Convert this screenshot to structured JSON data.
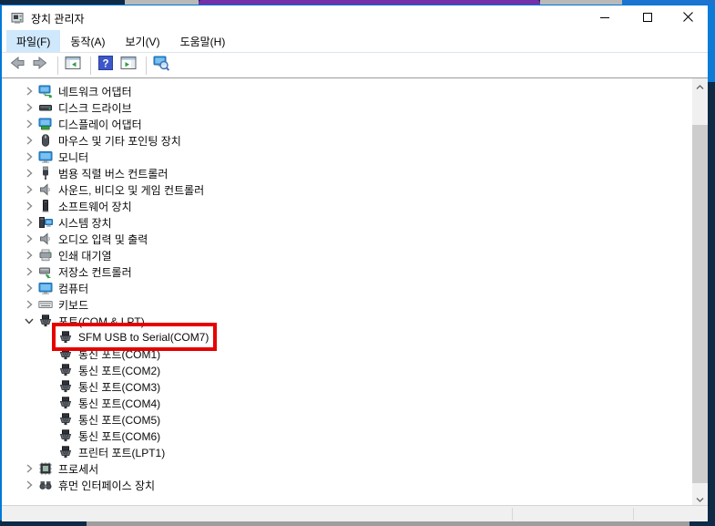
{
  "window": {
    "title": "장치 관리자",
    "app_icon": "device-manager",
    "controls": [
      {
        "name": "minimize",
        "icon": "minimize"
      },
      {
        "name": "maximize",
        "icon": "maximize"
      },
      {
        "name": "close",
        "icon": "close"
      }
    ]
  },
  "menu": {
    "items": [
      {
        "name": "file",
        "label": "파일(F)",
        "highlighted": true
      },
      {
        "name": "action",
        "label": "동작(A)",
        "highlighted": false
      },
      {
        "name": "view",
        "label": "보기(V)",
        "highlighted": false
      },
      {
        "name": "help",
        "label": "도움말(H)",
        "highlighted": false
      }
    ]
  },
  "toolbar": {
    "buttons": [
      {
        "name": "back",
        "icon": "back-arrow"
      },
      {
        "name": "forward",
        "icon": "forward-arrow"
      },
      {
        "name": "separator"
      },
      {
        "name": "console-tree",
        "icon": "console-tree"
      },
      {
        "name": "separator"
      },
      {
        "name": "help",
        "icon": "help"
      },
      {
        "name": "action-pane",
        "icon": "action-pane"
      },
      {
        "name": "separator"
      },
      {
        "name": "scan-hardware",
        "icon": "scan-hardware"
      }
    ]
  },
  "tree": {
    "items": [
      {
        "name": "network-adapters",
        "label": "네트워크 어댑터",
        "icon": "network-adapter",
        "level": 1,
        "chevron": "collapsed",
        "highlighted": false
      },
      {
        "name": "disk-drives",
        "label": "디스크 드라이브",
        "icon": "disk-drive",
        "level": 1,
        "chevron": "collapsed",
        "highlighted": false
      },
      {
        "name": "display-adapters",
        "label": "디스플레이 어댑터",
        "icon": "display-adapter",
        "level": 1,
        "chevron": "collapsed",
        "highlighted": false
      },
      {
        "name": "mice-pointing-devices",
        "label": "마우스 및 기타 포인팅 장치",
        "icon": "mouse",
        "level": 1,
        "chevron": "collapsed",
        "highlighted": false
      },
      {
        "name": "monitors",
        "label": "모니터",
        "icon": "monitor",
        "level": 1,
        "chevron": "collapsed",
        "highlighted": false
      },
      {
        "name": "usb-controllers",
        "label": "범용 직렬 버스 컨트롤러",
        "icon": "usb",
        "level": 1,
        "chevron": "collapsed",
        "highlighted": false
      },
      {
        "name": "sound-video-game-controllers",
        "label": "사운드, 비디오 및 게임 컨트롤러",
        "icon": "speaker",
        "level": 1,
        "chevron": "collapsed",
        "highlighted": false
      },
      {
        "name": "software-devices",
        "label": "소프트웨어 장치",
        "icon": "software-device",
        "level": 1,
        "chevron": "collapsed",
        "highlighted": false
      },
      {
        "name": "system-devices",
        "label": "시스템 장치",
        "icon": "system-device",
        "level": 1,
        "chevron": "collapsed",
        "highlighted": false
      },
      {
        "name": "audio-inputs-outputs",
        "label": "오디오 입력 및 출력",
        "icon": "speaker",
        "level": 1,
        "chevron": "collapsed",
        "highlighted": false
      },
      {
        "name": "print-queues",
        "label": "인쇄 대기열",
        "icon": "printer",
        "level": 1,
        "chevron": "collapsed",
        "highlighted": false
      },
      {
        "name": "storage-controllers",
        "label": "저장소 컨트롤러",
        "icon": "storage",
        "level": 1,
        "chevron": "collapsed",
        "highlighted": false
      },
      {
        "name": "computer",
        "label": "컴퓨터",
        "icon": "computer",
        "level": 1,
        "chevron": "collapsed",
        "highlighted": false
      },
      {
        "name": "keyboards",
        "label": "키보드",
        "icon": "keyboard",
        "level": 1,
        "chevron": "collapsed",
        "highlighted": false
      },
      {
        "name": "ports-com-lpt",
        "label": "포트(COM & LPT)",
        "icon": "serial-port",
        "level": 1,
        "chevron": "expanded",
        "highlighted": false
      },
      {
        "name": "sfm-usb-to-serial-com7",
        "label": "SFM USB to Serial(COM7)",
        "icon": "serial-port",
        "level": 2,
        "chevron": null,
        "highlighted": true
      },
      {
        "name": "com1",
        "label": "통신 포트(COM1)",
        "icon": "serial-port",
        "level": 2,
        "chevron": null,
        "highlighted": false
      },
      {
        "name": "com2",
        "label": "통신 포트(COM2)",
        "icon": "serial-port",
        "level": 2,
        "chevron": null,
        "highlighted": false
      },
      {
        "name": "com3",
        "label": "통신 포트(COM3)",
        "icon": "serial-port",
        "level": 2,
        "chevron": null,
        "highlighted": false
      },
      {
        "name": "com4",
        "label": "통신 포트(COM4)",
        "icon": "serial-port",
        "level": 2,
        "chevron": null,
        "highlighted": false
      },
      {
        "name": "com5",
        "label": "통신 포트(COM5)",
        "icon": "serial-port",
        "level": 2,
        "chevron": null,
        "highlighted": false
      },
      {
        "name": "com6",
        "label": "통신 포트(COM6)",
        "icon": "serial-port",
        "level": 2,
        "chevron": null,
        "highlighted": false
      },
      {
        "name": "lpt1",
        "label": "프린터 포트(LPT1)",
        "icon": "serial-port",
        "level": 2,
        "chevron": null,
        "highlighted": false
      },
      {
        "name": "processors",
        "label": "프로세서",
        "icon": "processor",
        "level": 1,
        "chevron": "collapsed",
        "highlighted": false
      },
      {
        "name": "human-interface-devices",
        "label": "휴먼 인터페이스 장치",
        "icon": "hid",
        "level": 1,
        "chevron": "collapsed",
        "highlighted": false
      }
    ]
  },
  "colors": {
    "accent_border": "#0078d7",
    "desktop_navy": "#0e2a47",
    "desktop_purple": "#7330a8",
    "desktop_blue": "#1b74cf",
    "menu_highlight": "#cfe8fc",
    "highlight_box_red": "#e60000",
    "scrollbar_track": "#f0f0f0",
    "scrollbar_thumb": "#cdcdcd",
    "statusbar_bg": "#f0f0f0"
  }
}
